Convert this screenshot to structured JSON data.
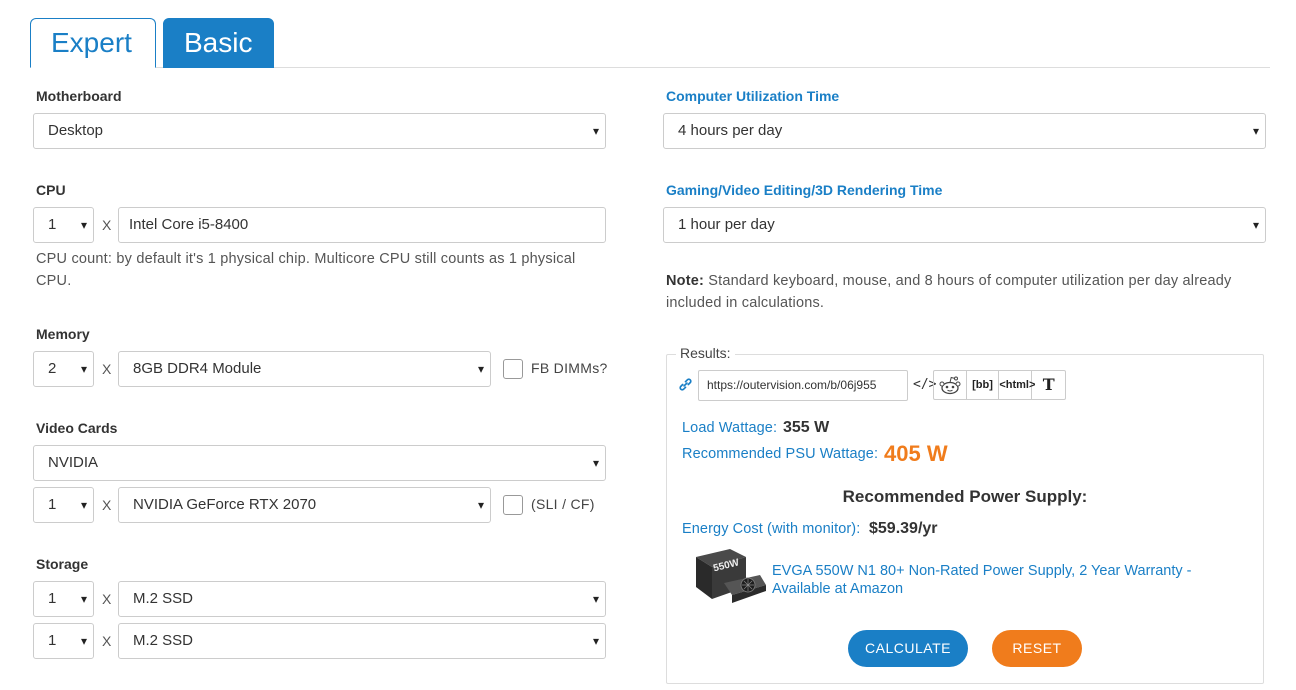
{
  "tabs": [
    {
      "label": "Expert"
    },
    {
      "label": "Basic"
    }
  ],
  "motherboard": {
    "label": "Motherboard",
    "value": "Desktop"
  },
  "cpu": {
    "label": "CPU",
    "count": "1",
    "x": "X",
    "model": "Intel Core i5-8400",
    "help_line1": "CPU count: by default it's 1 physical chip. Multicore CPU still counts as 1 physical",
    "help_line2": "CPU."
  },
  "memory": {
    "label": "Memory",
    "count": "2",
    "x": "X",
    "module": "8GB DDR4 Module",
    "fb_label": "FB DIMMs?"
  },
  "video": {
    "label": "Video Cards",
    "brand": "NVIDIA",
    "count": "1",
    "x": "X",
    "model": "NVIDIA GeForce RTX 2070",
    "sli_label": "(SLI / CF)"
  },
  "storage": {
    "label": "Storage",
    "rows": [
      {
        "count": "1",
        "x": "X",
        "type": "M.2 SSD"
      },
      {
        "count": "1",
        "x": "X",
        "type": "M.2 SSD"
      }
    ]
  },
  "utilization": {
    "label": "Computer Utilization Time",
    "value": "4 hours per day"
  },
  "gaming": {
    "label": "Gaming/Video Editing/3D Rendering Time",
    "value": "1 hour per day"
  },
  "note": {
    "bold": "Note:",
    "text": "Standard keyboard, mouse, and 8 hours of computer utilization per day already included in calculations."
  },
  "results": {
    "legend": "Results:",
    "url": "https://outervision.com/b/06j955",
    "embed": "</>",
    "share": {
      "bb": "[bb]",
      "html": "<html>",
      "t": "T"
    },
    "load_label": "Load Wattage:",
    "load_value": "355 W",
    "psu_label": "Recommended PSU Wattage:",
    "psu_value": "405 W",
    "rec_title": "Recommended Power Supply:",
    "energy_label": "Energy Cost (with monitor):",
    "energy_value": "$59.39/yr",
    "product_line1": "EVGA 550W N1 80+ Non-Rated Power Supply, 2 Year Warranty -",
    "product_line2": "Available at Amazon",
    "product_image_text": "550W"
  },
  "buttons": {
    "calculate": "CALCULATE",
    "reset": "RESET"
  },
  "colors": {
    "accent": "#1a7fc6",
    "orange": "#f07c1c"
  },
  "icons": [
    "link-icon",
    "embed-icon",
    "reddit-icon"
  ]
}
